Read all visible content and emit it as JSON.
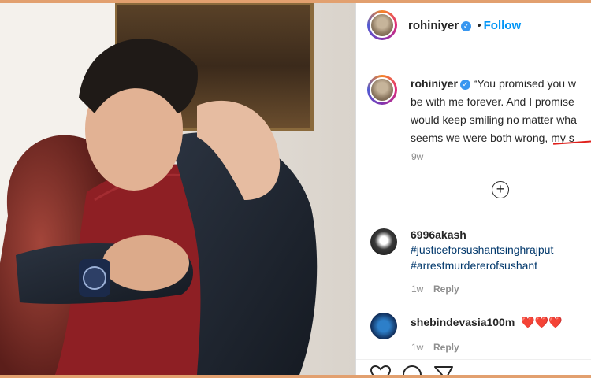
{
  "post": {
    "username": "rohiniyer",
    "follow_label": "Follow",
    "dot": "•",
    "caption_lines": [
      "“You promised you w",
      "be with me forever. And I promise",
      "would keep smiling no matter wha",
      "seems we were both wrong, my s"
    ],
    "caption_time": "9w",
    "load_more_icon": "plus-circle-icon"
  },
  "comments": [
    {
      "username": "6996akash",
      "lines": [
        "#justiceforsushantsinghrajput",
        "#arrestmurdererofsushant"
      ],
      "time": "1w",
      "reply_label": "Reply"
    },
    {
      "username": "shebindevasia100m",
      "lines": [
        "❤️❤️❤️"
      ],
      "time": "1w",
      "reply_label": "Reply"
    }
  ],
  "actions": {
    "icons": [
      "heart-icon",
      "comment-icon",
      "share-icon"
    ]
  },
  "colors": {
    "follow_blue": "#0095f6",
    "hashtag_blue": "#00376b",
    "underline_red": "#e0201b",
    "frame": "#e2a06f"
  }
}
